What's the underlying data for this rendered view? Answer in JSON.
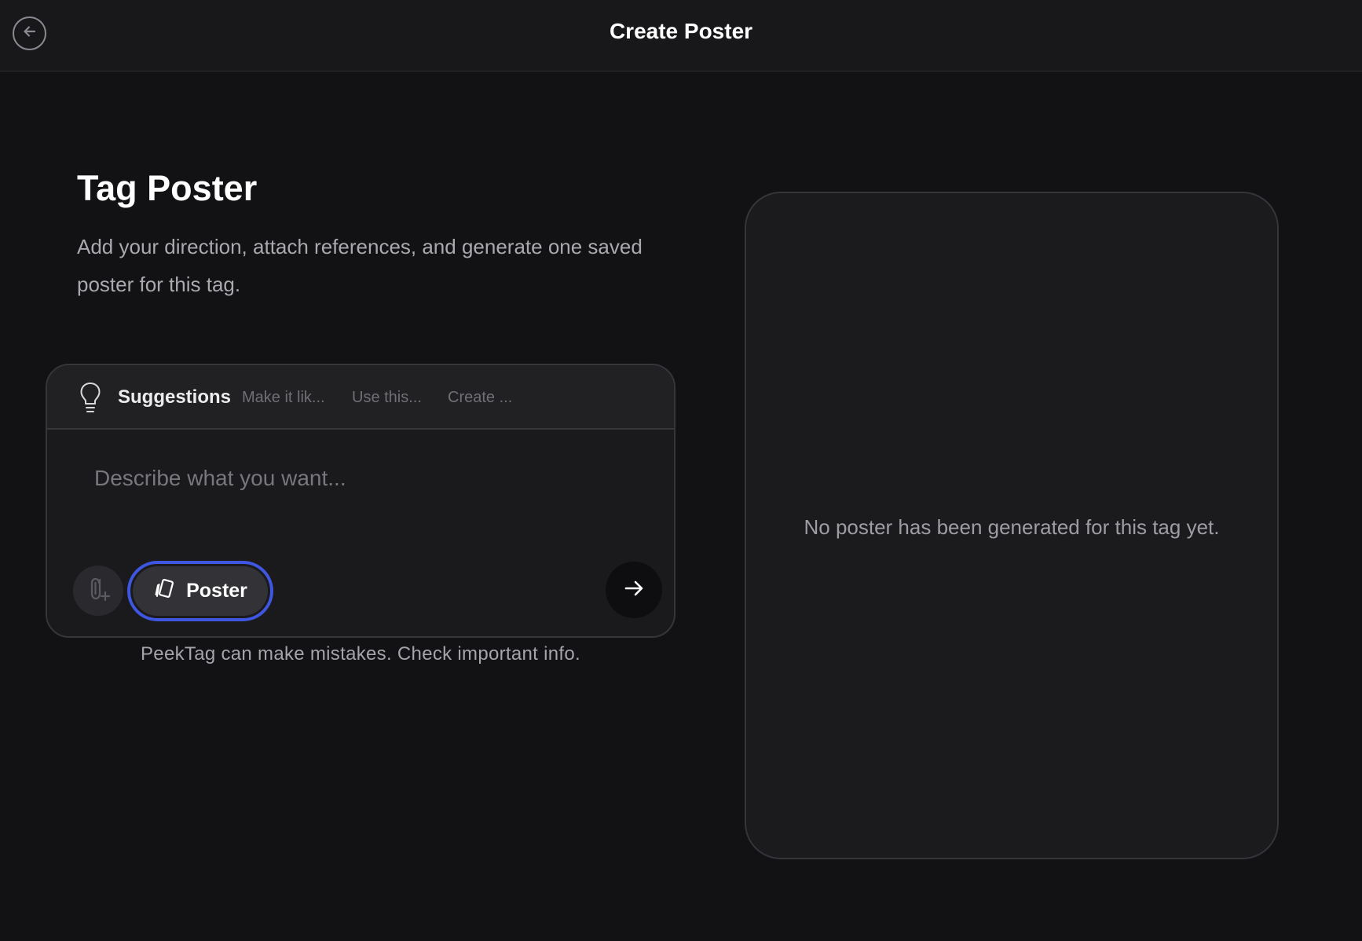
{
  "header": {
    "title": "Create Poster",
    "back_icon": "arrow-left-circle-icon"
  },
  "intro": {
    "title": "Tag Poster",
    "description": "Add your direction, attach references, and generate one saved poster for this tag."
  },
  "composer": {
    "suggestions_label": "Suggestions",
    "suggestions": [
      "Make it lik...",
      "Use this...",
      "Create ..."
    ],
    "input_placeholder": "Describe what you want...",
    "input_value": "",
    "mode_label": "Poster",
    "accent_color": "#3e56e0"
  },
  "disclaimer": "PeekTag can make mistakes. Check important info.",
  "preview": {
    "empty_text": "No poster has been generated for this tag yet."
  }
}
